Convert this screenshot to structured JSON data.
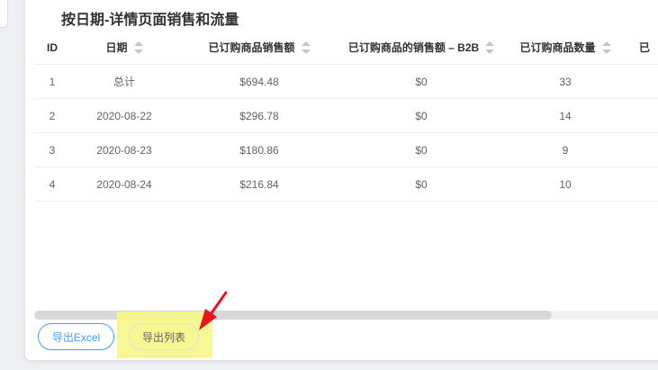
{
  "title": "按日期-详情页面销售和流量",
  "table": {
    "headers": [
      "ID",
      "日期",
      "已订购商品销售额",
      "已订购商品的销售额 – B2B",
      "已订购商品数量",
      "已"
    ],
    "rows": [
      [
        "1",
        "总计",
        "$694.48",
        "$0",
        "33"
      ],
      [
        "2",
        "2020-08-22",
        "$296.78",
        "$0",
        "14"
      ],
      [
        "3",
        "2020-08-23",
        "$180.86",
        "$0",
        "9"
      ],
      [
        "4",
        "2020-08-24",
        "$216.84",
        "$0",
        "10"
      ]
    ]
  },
  "buttons": {
    "export_excel": "导出Excel",
    "export_list": "导出列表"
  },
  "colors": {
    "accent": "#409eff",
    "highlight": "#f6f687",
    "arrow": "#e8141e"
  }
}
